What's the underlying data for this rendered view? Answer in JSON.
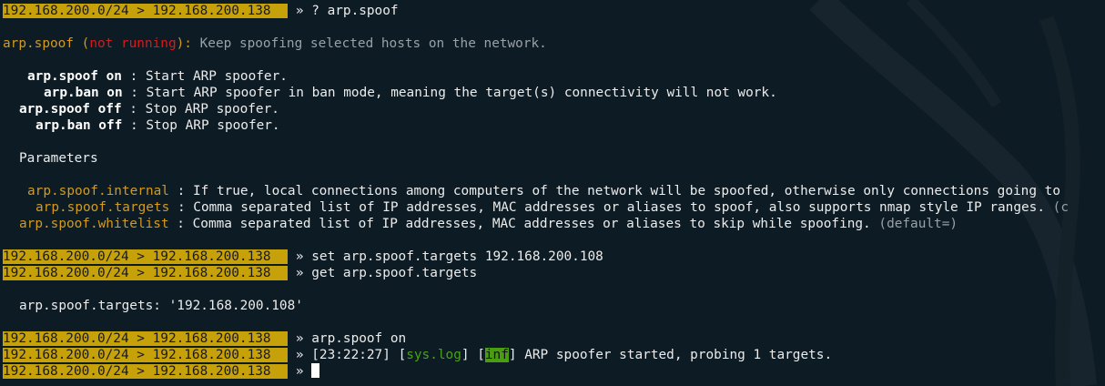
{
  "prompt": "192.168.200.0/24 > 192.168.200.138 ",
  "sep": " » ",
  "help": {
    "command": "? arp.spoof",
    "module": "arp.spoof",
    "state_open": " (",
    "state": "not running",
    "state_close": "): ",
    "description": "Keep spoofing selected hosts on the network.",
    "commands": [
      {
        "cmd": "arp.spoof on",
        "desc": "Start ARP spoofer."
      },
      {
        "cmd": "arp.ban on",
        "desc": "Start ARP spoofer in ban mode, meaning the target(s) connectivity will not work."
      },
      {
        "cmd": "arp.spoof off",
        "desc": "Stop ARP spoofer."
      },
      {
        "cmd": "arp.ban off",
        "desc": "Stop ARP spoofer."
      }
    ],
    "parameters_heading": "Parameters",
    "parameters": [
      {
        "name": "arp.spoof.internal",
        "desc": "If true, local connections among computers of the network will be spoofed, otherwise only connections going to"
      },
      {
        "name": "arp.spoof.targets",
        "desc": "Comma separated list of IP addresses, MAC addresses or aliases to spoof, also supports nmap style IP ranges.",
        "default": "(c"
      },
      {
        "name": "arp.spoof.whitelist",
        "desc": "Comma separated list of IP addresses, MAC addresses or aliases to skip while spoofing.",
        "default": "(default=)"
      }
    ]
  },
  "session": {
    "cmd_set": "set arp.spoof.targets 192.168.200.108",
    "cmd_get": "get arp.spoof.targets",
    "get_output": "arp.spoof.targets: '192.168.200.108'",
    "cmd_on": "arp.spoof on",
    "log_time": "[23:22:27]",
    "log_tag_open": "[",
    "log_tag": "sys.log",
    "log_tag_close": "]",
    "log_level": "inf",
    "log_message": "ARP spoofer started, probing 1 targets."
  },
  "colors": {
    "background": "#0d1b24",
    "prompt_bg": "#c6a10a",
    "accent_orange": "#d39a1d",
    "status_red": "#d41c1c",
    "log_green": "#4aa317"
  }
}
